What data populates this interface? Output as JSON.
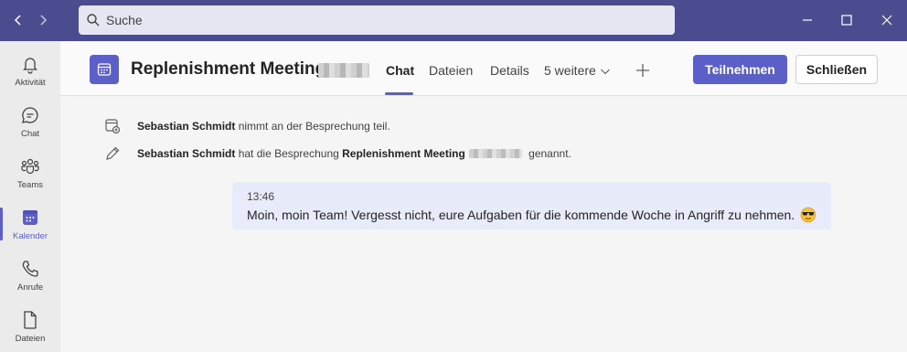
{
  "titlebar": {
    "search_placeholder": "Suche",
    "icons": [
      "chevron-left-icon",
      "chevron-right-icon",
      "search-icon",
      "minimize-icon",
      "maximize-icon",
      "close-icon"
    ]
  },
  "rail": {
    "items": [
      {
        "label": "Aktivität",
        "icon": "bell-icon"
      },
      {
        "label": "Chat",
        "icon": "chat-icon"
      },
      {
        "label": "Teams",
        "icon": "teams-icon"
      },
      {
        "label": "Kalender",
        "icon": "calendar-icon",
        "active": true
      },
      {
        "label": "Anrufe",
        "icon": "phone-icon"
      },
      {
        "label": "Dateien",
        "icon": "file-icon"
      }
    ]
  },
  "header": {
    "title": "Replenishment Meeting",
    "tabs": [
      "Chat",
      "Dateien",
      "Details",
      "5 weitere"
    ],
    "active_tab": "Chat",
    "join_label": "Teilnehmen",
    "close_label": "Schließen"
  },
  "events": [
    {
      "name": "Sebastian Schmidt",
      "text": " nimmt an der Besprechung teil."
    },
    {
      "name": "Sebastian Schmidt",
      "text_before": " hat die Besprechung ",
      "meeting": "Replenishment Meeting",
      "text_after": " genannt."
    }
  ],
  "message": {
    "time": "13:46",
    "text": "Moin, moin Team! Vergesst nicht, eure Aufgaben für die kommende Woche in Angriff zu nehmen."
  },
  "colors": {
    "titlebar": "#4b4b8f",
    "accent": "#5b5fc7",
    "bubble": "#e8ebfa"
  }
}
